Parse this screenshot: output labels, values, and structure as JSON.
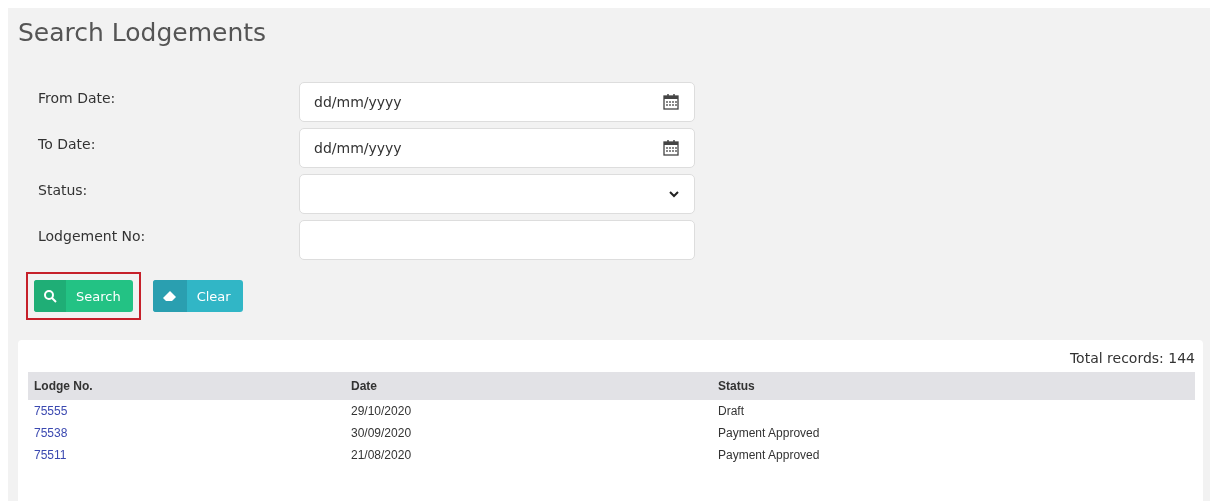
{
  "title": "Search Lodgements",
  "fields": [
    {
      "label": "From Date:",
      "kind": "date",
      "placeholder": "dd/mm/yyyy"
    },
    {
      "label": "To Date:",
      "kind": "date",
      "placeholder": "dd/mm/yyyy"
    },
    {
      "label": "Status:",
      "kind": "select"
    },
    {
      "label": "Lodgement No:",
      "kind": "text"
    }
  ],
  "buttons": [
    {
      "label": "Search",
      "kind": "search",
      "highlighted": true
    },
    {
      "label": "Clear",
      "kind": "clear",
      "highlighted": false
    }
  ],
  "table": {
    "total": "Total records: 144",
    "columns": [
      "Lodge No.",
      "Date",
      "Status"
    ],
    "rows": [
      [
        "75555",
        "29/10/2020",
        "Draft"
      ],
      [
        "75538",
        "30/09/2020",
        "Payment Approved"
      ],
      [
        "75511",
        "21/08/2020",
        "Payment Approved"
      ]
    ]
  }
}
